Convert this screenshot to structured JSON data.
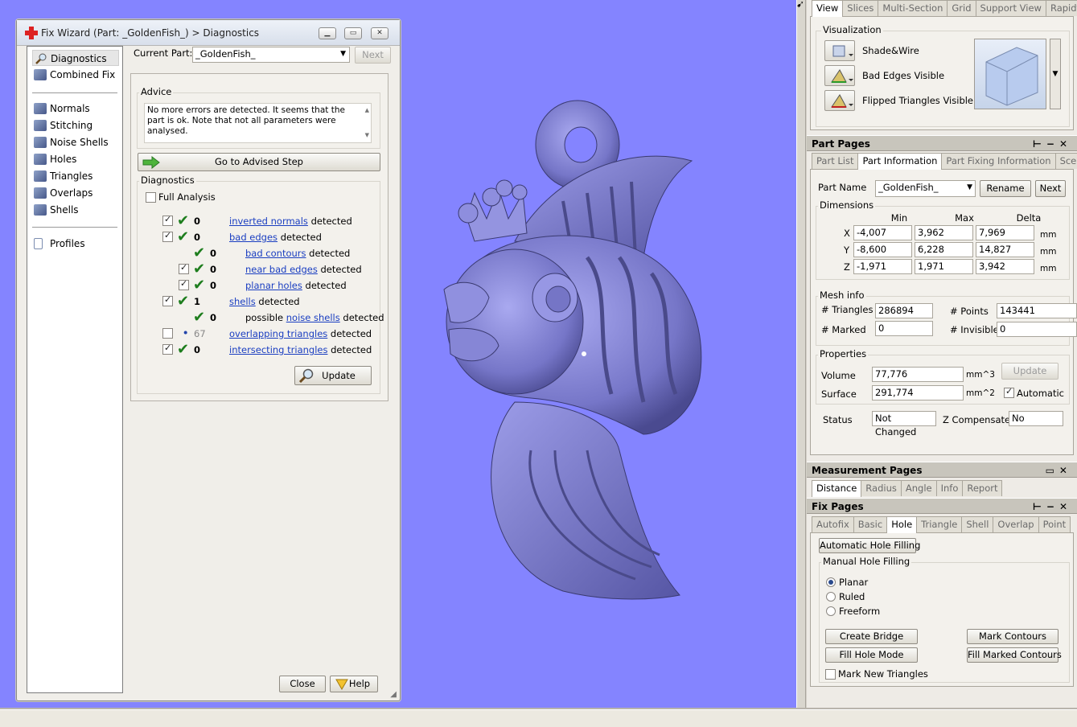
{
  "wizard": {
    "title": "Fix Wizard (Part: _GoldenFish_) > Diagnostics",
    "nav": [
      {
        "label": "Diagnostics",
        "icon": "magnifier-icon"
      },
      {
        "label": "Combined Fix",
        "icon": "combined-fix-icon"
      },
      {
        "label": "Normals",
        "icon": "normals-icon"
      },
      {
        "label": "Stitching",
        "icon": "stitching-icon"
      },
      {
        "label": "Noise Shells",
        "icon": "noise-shells-icon"
      },
      {
        "label": "Holes",
        "icon": "holes-icon"
      },
      {
        "label": "Triangles",
        "icon": "triangles-icon"
      },
      {
        "label": "Overlaps",
        "icon": "overlaps-icon"
      },
      {
        "label": "Shells",
        "icon": "shells-icon"
      },
      {
        "label": "Profiles",
        "icon": "document-icon"
      }
    ],
    "current_part_label": "Current Part:",
    "current_part_value": "_GoldenFish_",
    "next_label": "Next",
    "advice_title": "Advice",
    "advice_text": "No more errors are detected. It seems that the part is ok. Note that not all parameters were analysed.",
    "advised_step_label": "Go to Advised Step",
    "diagnostics_title": "Diagnostics",
    "full_analysis_label": "Full Analysis",
    "rows": [
      {
        "count": "0",
        "link": "inverted normals",
        "suffix": "detected",
        "checked": true
      },
      {
        "count": "0",
        "link": "bad edges",
        "suffix": "detected",
        "checked": true
      },
      {
        "count": "0",
        "link": "bad contours",
        "suffix": "detected"
      },
      {
        "count": "0",
        "link": "near bad edges",
        "suffix": "detected",
        "checked": true
      },
      {
        "count": "0",
        "link": "planar holes",
        "suffix": "detected",
        "checked": true
      },
      {
        "count": "1",
        "link": "shells",
        "suffix": "detected",
        "checked": true
      },
      {
        "count": "0",
        "prefix": "possible",
        "link": "noise shells",
        "suffix": "detected"
      },
      {
        "count": "67",
        "link": "overlapping triangles",
        "suffix": "detected",
        "checked": false
      },
      {
        "count": "0",
        "link": "intersecting triangles",
        "suffix": "detected",
        "checked": true
      }
    ],
    "update_label": "Update",
    "close_label": "Close",
    "help_label": "Help"
  },
  "right": {
    "view_tabs": [
      "View",
      "Slices",
      "Multi-Section",
      "Grid",
      "Support View",
      "Rapidfit View"
    ],
    "visualization_title": "Visualization",
    "vis_items": [
      "Shade&Wire",
      "Bad Edges Visible",
      "Flipped Triangles Visible"
    ],
    "part_pages_title": "Part Pages",
    "part_tabs": [
      "Part List",
      "Part Information",
      "Part Fixing Information",
      "Scenes"
    ],
    "part_name_label": "Part Name",
    "part_name_value": "_GoldenFish_",
    "rename_label": "Rename",
    "next_label": "Next",
    "dimensions_title": "Dimensions",
    "dim_headers": [
      "Min",
      "Max",
      "Delta"
    ],
    "dims": [
      {
        "axis": "X",
        "min": "-4,007",
        "max": "3,962",
        "delta": "7,969",
        "unit": "mm"
      },
      {
        "axis": "Y",
        "min": "-8,600",
        "max": "6,228",
        "delta": "14,827",
        "unit": "mm"
      },
      {
        "axis": "Z",
        "min": "-1,971",
        "max": "1,971",
        "delta": "3,942",
        "unit": "mm"
      }
    ],
    "mesh_title": "Mesh info",
    "triangles_label": "# Triangles",
    "triangles_value": "286894",
    "points_label": "# Points",
    "points_value": "143441",
    "marked_label": "# Marked",
    "marked_value": "0",
    "invisible_label": "# Invisible",
    "invisible_value": "0",
    "properties_title": "Properties",
    "volume_label": "Volume",
    "volume_value": "77,776",
    "volume_unit": "mm^3",
    "surface_label": "Surface",
    "surface_value": "291,774",
    "surface_unit": "mm^2",
    "prop_update_label": "Update",
    "automatic_label": "Automatic",
    "status_label": "Status",
    "status_value": "Not Changed",
    "zcomp_label": "Z Compensated",
    "zcomp_value": "No",
    "measurement_title": "Measurement Pages",
    "measure_tabs": [
      "Distance",
      "Radius",
      "Angle",
      "Info",
      "Report"
    ],
    "fix_title": "Fix Pages",
    "fix_tabs": [
      "Autofix",
      "Basic",
      "Hole",
      "Triangle",
      "Shell",
      "Overlap",
      "Point"
    ],
    "auto_hole_label": "Automatic Hole Filling",
    "manual_hole_title": "Manual Hole Filling",
    "radios": [
      "Planar",
      "Ruled",
      "Freeform"
    ],
    "create_bridge_label": "Create Bridge",
    "mark_contours_label": "Mark Contours",
    "fill_hole_mode_label": "Fill Hole Mode",
    "fill_marked_label": "Fill Marked Contours",
    "mark_new_label": "Mark New Triangles"
  }
}
